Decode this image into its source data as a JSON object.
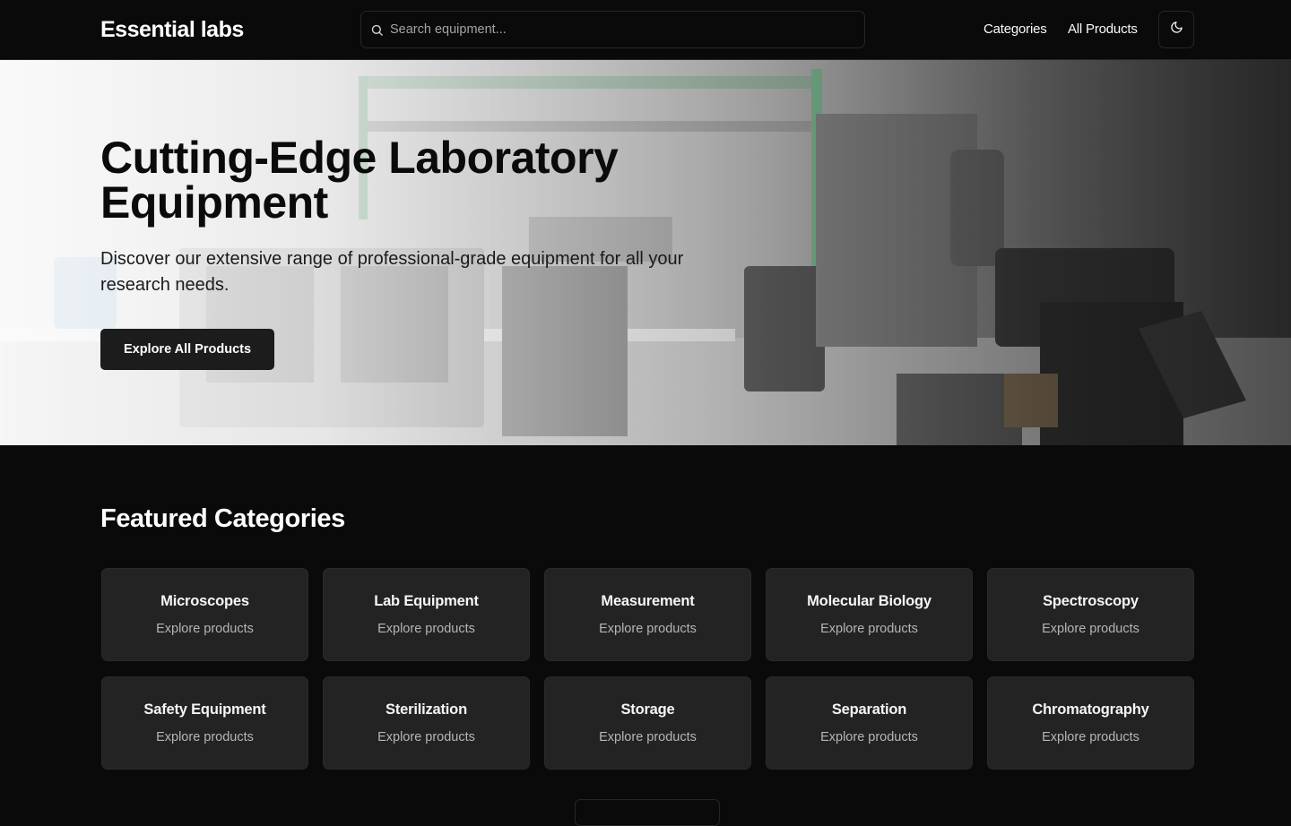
{
  "header": {
    "logo": "Essential labs",
    "search_placeholder": "Search equipment...",
    "nav": [
      "Categories",
      "All Products"
    ],
    "theme_icon": "moon-icon"
  },
  "hero": {
    "title": "Cutting-Edge Laboratory Equipment",
    "subtitle": "Discover our extensive range of professional-grade equipment for all your research needs.",
    "cta": "Explore All Products"
  },
  "featured": {
    "title": "Featured Categories",
    "categories": [
      {
        "name": "Microscopes",
        "sub": "Explore products"
      },
      {
        "name": "Lab Equipment",
        "sub": "Explore products"
      },
      {
        "name": "Measurement",
        "sub": "Explore products"
      },
      {
        "name": "Molecular Biology",
        "sub": "Explore products"
      },
      {
        "name": "Spectroscopy",
        "sub": "Explore products"
      },
      {
        "name": "Safety Equipment",
        "sub": "Explore products"
      },
      {
        "name": "Sterilization",
        "sub": "Explore products"
      },
      {
        "name": "Storage",
        "sub": "Explore products"
      },
      {
        "name": "Separation",
        "sub": "Explore products"
      },
      {
        "name": "Chromatography",
        "sub": "Explore products"
      }
    ]
  },
  "colors": {
    "background": "#0a0a0a",
    "card": "#232323",
    "button": "#1c1c1c"
  }
}
